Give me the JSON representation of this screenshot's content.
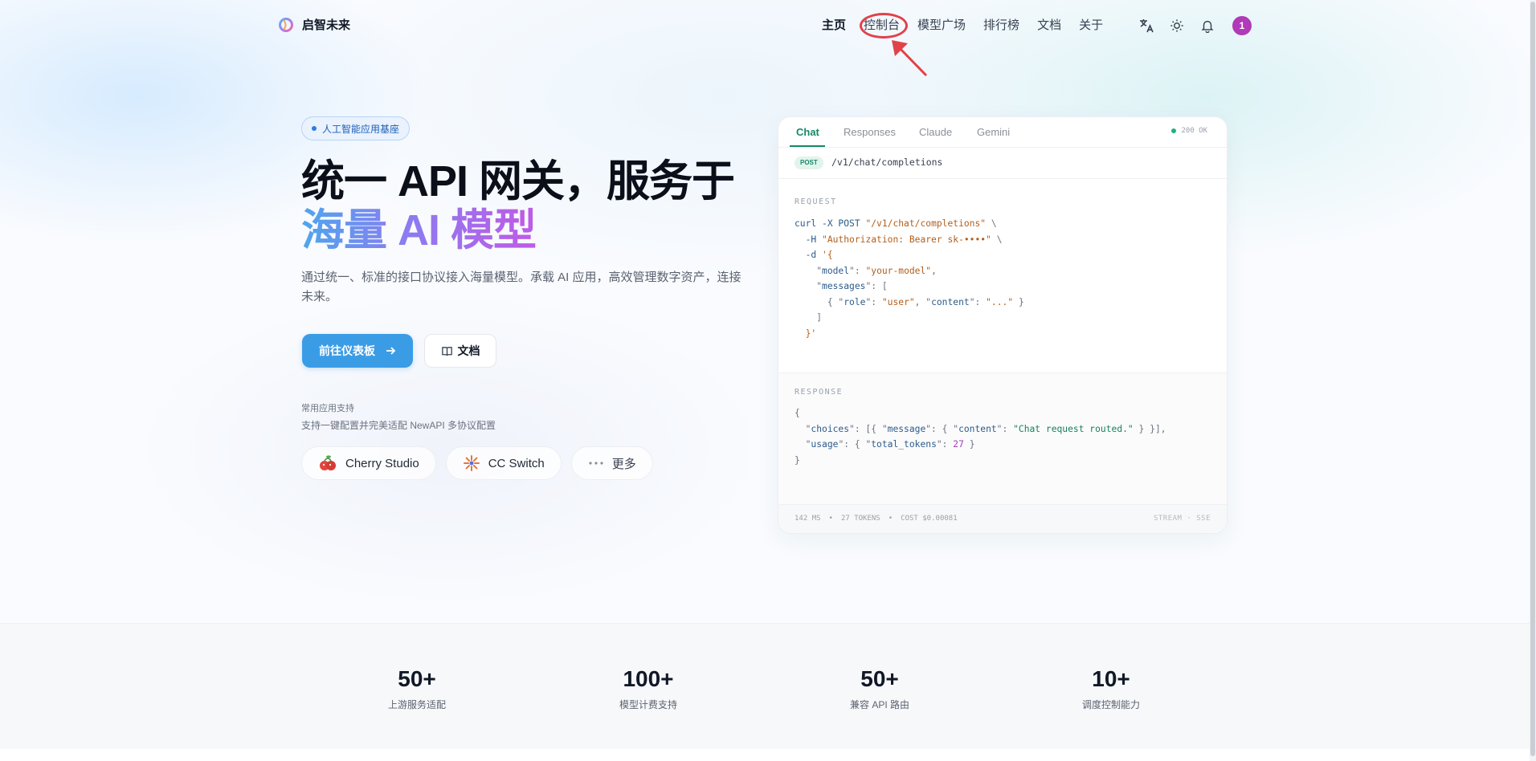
{
  "brand": {
    "name": "启智未来",
    "logo_icon": "ring-logo-icon"
  },
  "nav": {
    "items": [
      {
        "label": "主页",
        "active": true
      },
      {
        "label": "控制台",
        "active": false,
        "annotated": true
      },
      {
        "label": "模型广场",
        "active": false
      },
      {
        "label": "排行榜",
        "active": false
      },
      {
        "label": "文档",
        "active": false
      },
      {
        "label": "关于",
        "active": false
      }
    ],
    "icons": [
      "translate-icon",
      "sun-icon",
      "bell-icon"
    ],
    "avatar_text": "1"
  },
  "hero": {
    "badge": "人工智能应用基座",
    "title_line1": "统一 API 网关，服务于",
    "title_line2": "海量 AI 模型",
    "description": "通过统一、标准的接口协议接入海量模型。承载 AI 应用，高效管理数字资产，连接未来。",
    "primary_button": "前往仪表板",
    "secondary_button": "文档",
    "apps_title": "常用应用支持",
    "apps_subtitle": "支持一键配置并完美适配 NewAPI 多协议配置",
    "apps": [
      {
        "name": "Cherry Studio",
        "icon": "cherry-icon"
      },
      {
        "name": "CC Switch",
        "icon": "sunburst-icon"
      },
      {
        "name": "更多",
        "icon": "ellipsis-icon"
      }
    ]
  },
  "code_card": {
    "tabs": [
      "Chat",
      "Responses",
      "Claude",
      "Gemini"
    ],
    "active_tab": "Chat",
    "status": "200 OK",
    "method": "POST",
    "path": "/v1/chat/completions",
    "request_label": "REQUEST",
    "response_label": "RESPONSE",
    "metrics": {
      "ms": "142",
      "ms_unit": "MS",
      "tokens": "27",
      "tokens_unit": "TOKENS",
      "cost_label": "COST",
      "cost": "$0.00081"
    },
    "stream_label": "STREAM · SSE"
  },
  "stats": [
    {
      "value": "50+",
      "label": "上游服务适配"
    },
    {
      "value": "100+",
      "label": "模型计费支持"
    },
    {
      "value": "50+",
      "label": "兼容 API 路由"
    },
    {
      "value": "10+",
      "label": "调度控制能力"
    }
  ],
  "colors": {
    "accent": "#3b9ce6",
    "tab_active": "#15886a",
    "annotation": "#e0424a",
    "avatar": "#b03ab8"
  }
}
